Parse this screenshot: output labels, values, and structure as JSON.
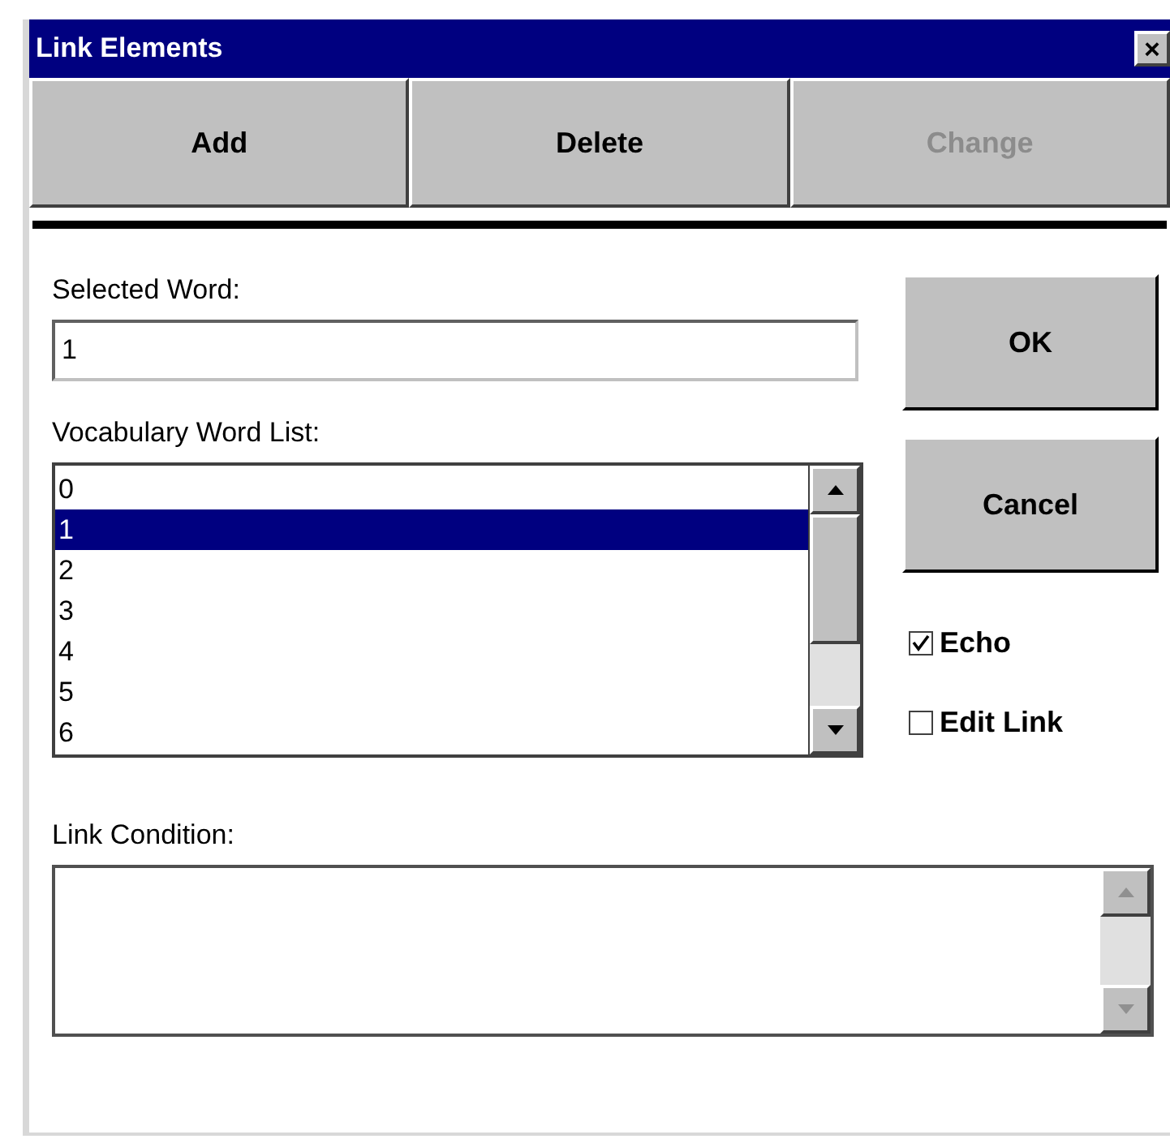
{
  "window": {
    "title": "Link Elements",
    "close": "×"
  },
  "toolbar": [
    {
      "label": "Add",
      "disabled": false
    },
    {
      "label": "Delete",
      "disabled": false
    },
    {
      "label": "Change",
      "disabled": true
    }
  ],
  "selected_word": {
    "label": "Selected Word:",
    "value": "1"
  },
  "vocabulary": {
    "label": "Vocabulary Word List:",
    "items": [
      {
        "text": "0",
        "selected": false
      },
      {
        "text": "1",
        "selected": true
      },
      {
        "text": "2",
        "selected": false
      },
      {
        "text": "3",
        "selected": false
      },
      {
        "text": "4",
        "selected": false
      },
      {
        "text": "5",
        "selected": false
      },
      {
        "text": "6",
        "selected": false
      }
    ]
  },
  "buttons": [
    "OK",
    "Cancel"
  ],
  "options": [
    {
      "label": "Echo",
      "checked": true
    },
    {
      "label": "Edit Link",
      "checked": false
    }
  ],
  "link_condition": {
    "label": "Link Condition:",
    "disabled": true
  }
}
